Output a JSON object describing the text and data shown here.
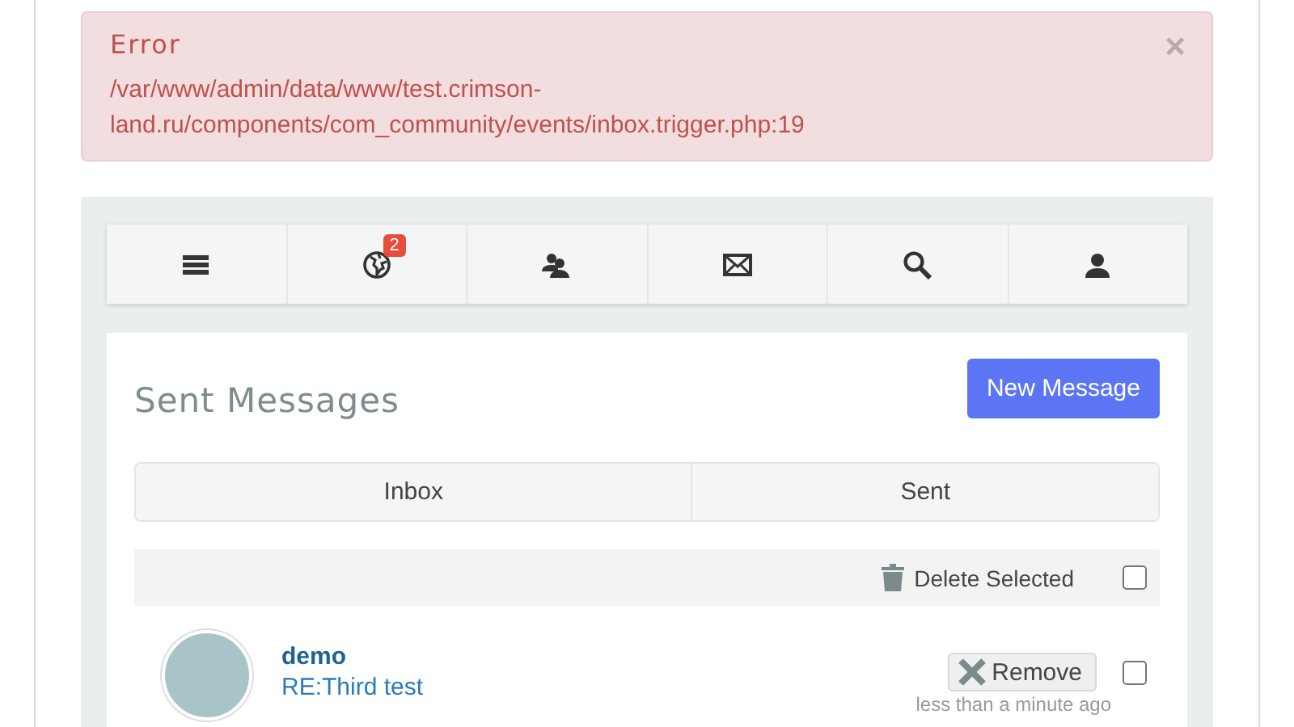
{
  "alert": {
    "title": "Error",
    "message": "/var/www/admin/data/www/test.crimson-land.ru/components/com_community/events/inbox.trigger.php:19",
    "close": "×"
  },
  "toolbar": [
    {
      "kind": "menu"
    },
    {
      "kind": "globe",
      "badge": "2"
    },
    {
      "kind": "friends"
    },
    {
      "kind": "mail"
    },
    {
      "kind": "search"
    },
    {
      "kind": "profile"
    }
  ],
  "heading": "Sent Messages",
  "new_button": "New Message",
  "tabs": [
    "Inbox",
    "Sent"
  ],
  "bulk": {
    "label": "Delete Selected",
    "checked": false
  },
  "messages": [
    {
      "sender": "demo",
      "subject": "RE:Third test",
      "remove": "Remove",
      "checked": false,
      "time": "less than a minute ago"
    }
  ]
}
